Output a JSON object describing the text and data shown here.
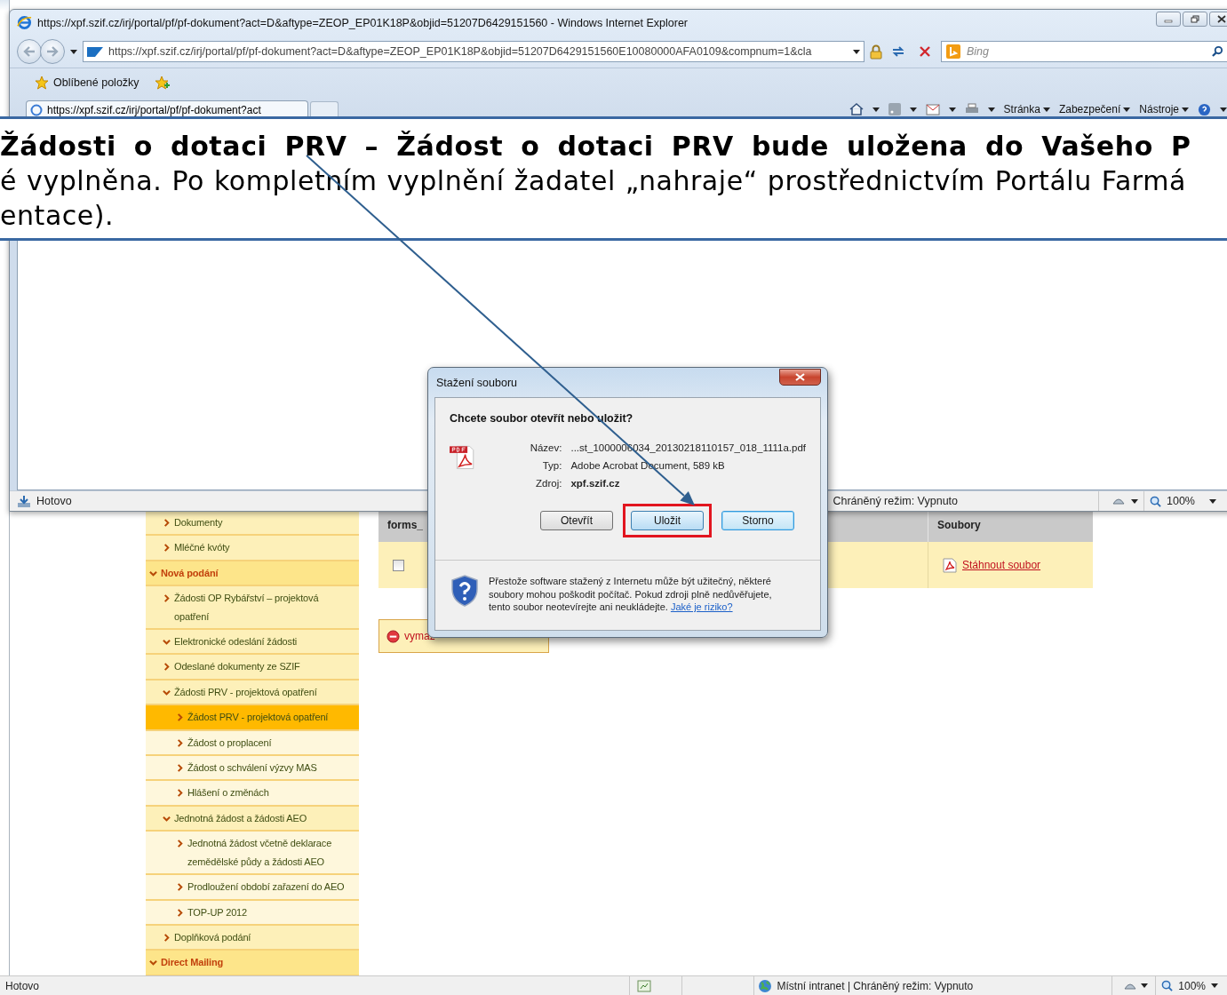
{
  "background_window": {
    "sidebar": {
      "continued_items": [
        {
          "label": "Dokumenty",
          "expanded": false,
          "selected": false
        },
        {
          "label": "Mléčné kvóty",
          "expanded": false,
          "selected": false
        }
      ],
      "items": [
        {
          "label": "Nová podání",
          "expanded": true,
          "selected": false,
          "children": [
            {
              "label": "Žádosti OP Rybářství – projektová opatření",
              "expanded": false,
              "selected": false
            },
            {
              "label": "Elektronické odeslání žádosti",
              "expanded": true,
              "selected": false
            },
            {
              "label": "Odeslané dokumenty ze SZIF",
              "expanded": false,
              "selected": false
            },
            {
              "label": "Žádosti PRV - projektová opatření",
              "expanded": true,
              "selected": false,
              "children": [
                {
                  "label": "Žádost PRV - projektová opatření",
                  "expanded": false,
                  "selected": true
                },
                {
                  "label": "Žádost o proplacení",
                  "expanded": false,
                  "selected": false
                },
                {
                  "label": "Žádost o schválení výzvy MAS",
                  "expanded": false,
                  "selected": false
                },
                {
                  "label": "Hlášení o změnách",
                  "expanded": false,
                  "selected": false
                }
              ]
            },
            {
              "label": "Jednotná žádost a žádosti AEO",
              "expanded": true,
              "selected": false,
              "children": [
                {
                  "label": "Jednotná žádost včetně deklarace zemědělské půdy a žádosti AEO",
                  "expanded": false,
                  "selected": false
                },
                {
                  "label": "Prodloužení období zařazení do AEO",
                  "expanded": false,
                  "selected": false
                },
                {
                  "label": "TOP-UP 2012",
                  "expanded": false,
                  "selected": false
                }
              ]
            },
            {
              "label": "Doplňková podání",
              "expanded": false,
              "selected": false
            }
          ]
        },
        {
          "label": "Direct Mailing",
          "expanded": true,
          "selected": false
        }
      ]
    },
    "table": {
      "columns": [
        "forms_",
        "Soubory"
      ],
      "rows": [
        {
          "checked": false,
          "link": "Stáhnout soubor"
        }
      ]
    },
    "delete_button": "vymaz",
    "status_bar": {
      "status": "Hotovo",
      "zone": "Místní intranet | Chráněný režim: Vypnuto",
      "zoom": "100%"
    }
  },
  "browser_window": {
    "title": "https://xpf.szif.cz/irj/portal/pf/pf-dokument?act=D&aftype=ZEOP_EP01K18P&objid=51207D6429151560 - Windows Internet Explorer",
    "address": "https://xpf.szif.cz/irj/portal/pf/pf-dokument?act=D&aftype=ZEOP_EP01K18P&objid=51207D6429151560E10080000AFA0109&compnum=1&cla",
    "search_placeholder": "Bing",
    "favorites": "Oblíbené položky",
    "tab": "https://xpf.szif.cz/irj/portal/pf/pf-dokument?act",
    "command_menus": [
      "Stránka",
      "Zabezpečení",
      "Nástroje"
    ],
    "status_bar": {
      "status": "Hotovo",
      "protected_mode": "Chráněný režim: Vypnuto",
      "zoom": "100%"
    }
  },
  "banner": {
    "lines": [
      {
        "text": "Žádosti o dotaci PRV – Žádost o dotaci PRV bude uložena do Vašeho P",
        "bold": true
      },
      {
        "text": "é vyplněna. Po kompletním vyplnění žadatel „nahraje“ prostřednictvím Portálu Farmá",
        "bold": false
      },
      {
        "text": "entace).",
        "bold": false
      }
    ]
  },
  "dialog": {
    "title": "Stažení souboru",
    "question": "Chcete soubor otevřít nebo uložit?",
    "fields": [
      {
        "label": "Název:",
        "value": "...st_1000006034_20130218110157_018_1111a.pdf",
        "bold": false
      },
      {
        "label": "Typ:",
        "value": "Adobe Acrobat Document, 589 kB",
        "bold": false
      },
      {
        "label": "Zdroj:",
        "value": "xpf.szif.cz",
        "bold": true
      }
    ],
    "buttons": [
      {
        "label": "Otevřít",
        "kind": "normal",
        "highlighted": false
      },
      {
        "label": "Uložit",
        "kind": "hot",
        "highlighted": true
      },
      {
        "label": "Storno",
        "kind": "focused",
        "highlighted": false
      }
    ],
    "warning": "Přestože software stažený z Internetu může být užitečný, některé soubory mohou poškodit počítač. Pokud zdroji plně nedůvěřujete, tento soubor neotevírejte ani neukládejte.",
    "warning_link": "Jaké je riziko?"
  }
}
